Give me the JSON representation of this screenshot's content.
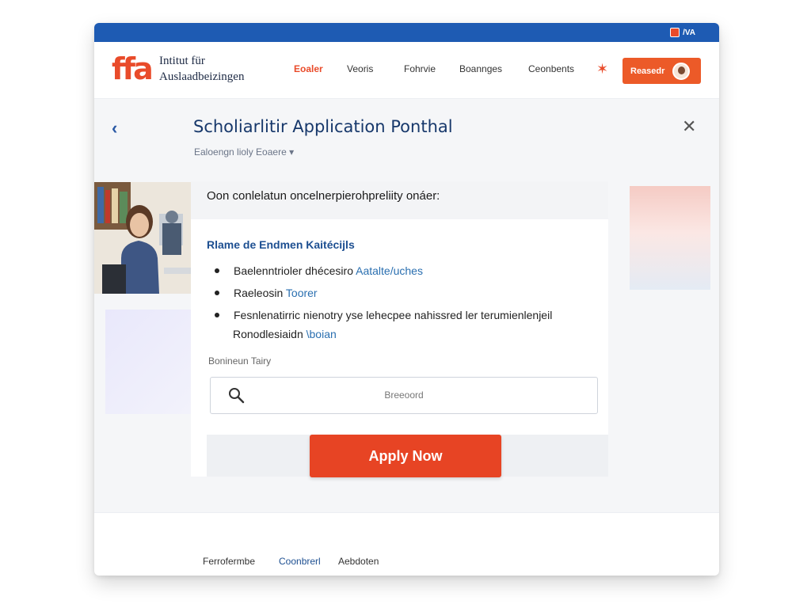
{
  "topbar": {
    "badge_label": "/VA"
  },
  "header": {
    "logo_text": "ffa",
    "org_name_line1": "Intitut für",
    "org_name_line2": "Auslaadbeizingen",
    "nav": [
      {
        "label": "Eoaler",
        "active": true
      },
      {
        "label": "Veoris",
        "active": false
      },
      {
        "label": "Fohrvie",
        "active": false
      },
      {
        "label": "Boannges",
        "active": false
      },
      {
        "label": "Ceonbents",
        "active": false
      }
    ],
    "login_label": "Reasedr"
  },
  "page": {
    "title": "Scholiarlitir Application Ponthal",
    "breadcrumb": "Ealoengn lioly Eoaere ▾"
  },
  "panel": {
    "question": "Oon conlelatun oncelnerpierohpreliity onáer:",
    "section_title": "Rlame de Endmen Kaitécijls",
    "requirements": [
      {
        "text": "Baelenntrioler dhécesiro ",
        "link": "Aatalte/uches"
      },
      {
        "text": "Raeleosin ",
        "link": "Toorer"
      },
      {
        "text": "Fesnlenatirric nienotry yse lehecpee nahissred ler terumienlenjeil",
        "link": ""
      }
    ],
    "requirement_continued": {
      "text": "Ronodlesiaidn ",
      "link": "\\boian"
    },
    "field_label": "Bonineun Tairy",
    "field_value": "Breeoord",
    "apply_label": "Apply Now"
  },
  "footer": {
    "links": [
      {
        "label": "Ferrofermbe"
      },
      {
        "label": "Coonbrerl"
      },
      {
        "label": "Aebdoten"
      }
    ]
  },
  "colors": {
    "accent": "#e94b2a",
    "brand_blue": "#1e5bb3",
    "title_blue": "#17386b"
  },
  "icons": [
    "flag-icon",
    "star-icon",
    "back-icon",
    "close-icon",
    "search-icon"
  ]
}
